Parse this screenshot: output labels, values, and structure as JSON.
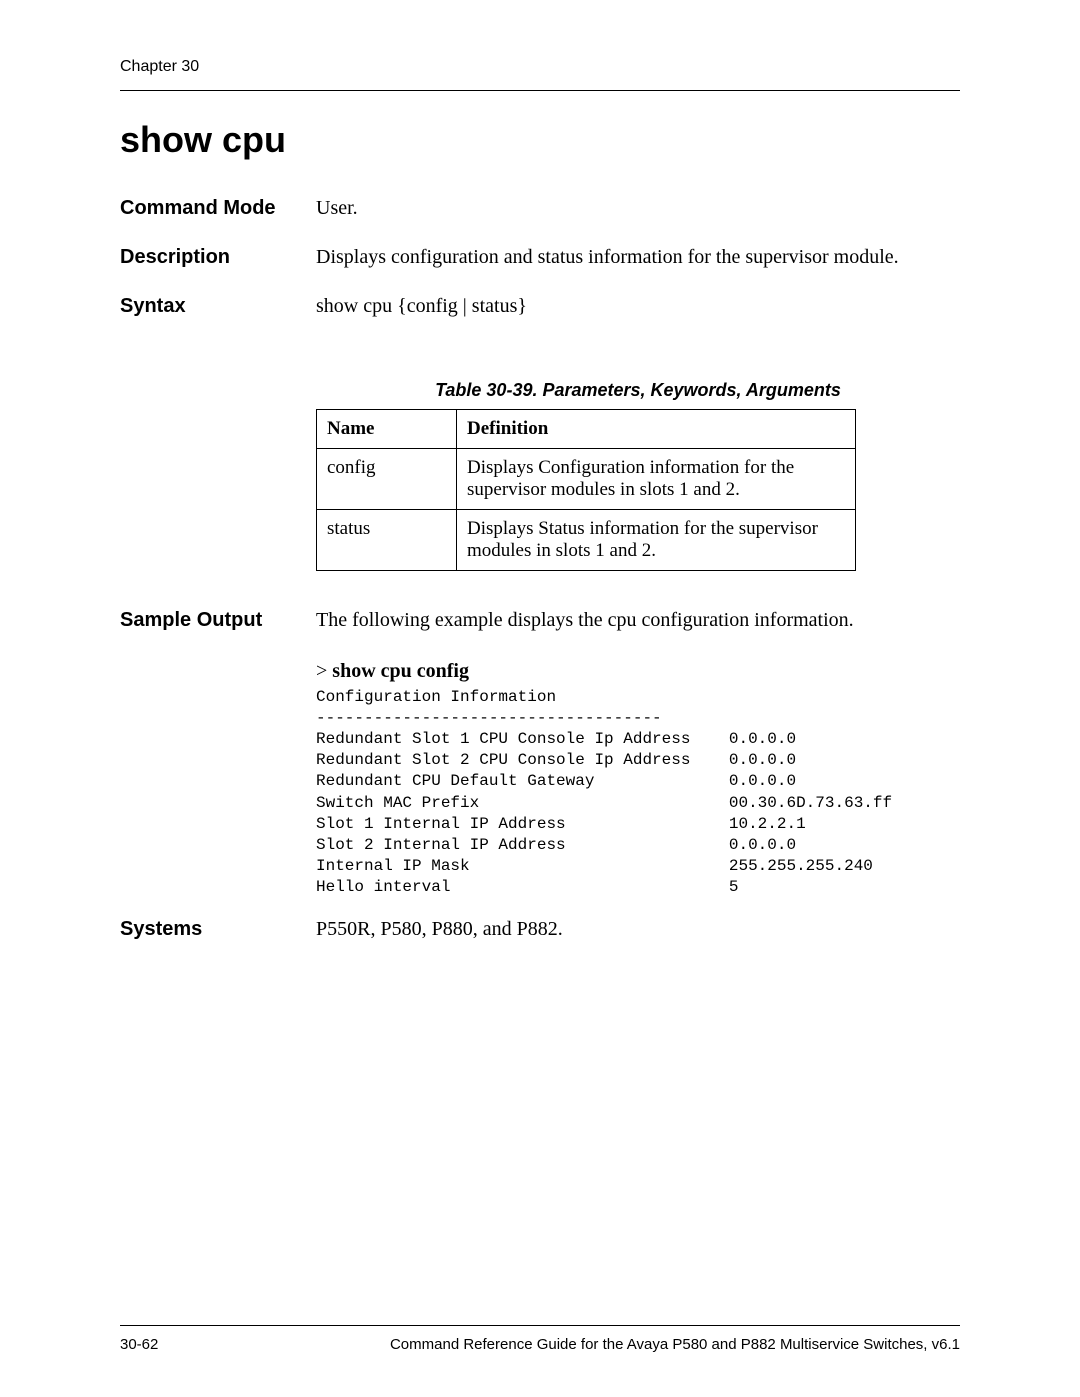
{
  "header": {
    "chapter_label": "Chapter 30"
  },
  "title": "show cpu",
  "sections": {
    "command_mode": {
      "label": "Command Mode",
      "value": "User."
    },
    "description": {
      "label": "Description",
      "value": "Displays configuration and status information for the supervisor module."
    },
    "syntax": {
      "label": "Syntax",
      "value": "show cpu {config | status}"
    },
    "sample_output": {
      "label": "Sample Output",
      "intro": "The following example displays the cpu configuration information."
    },
    "systems": {
      "label": "Systems",
      "value": "P550R, P580, P880, and P882."
    }
  },
  "table": {
    "caption": "Table 30-39.  Parameters, Keywords, Arguments",
    "headers": {
      "name": "Name",
      "definition": "Definition"
    },
    "rows": [
      {
        "name": "config",
        "definition": "Displays Configuration information for the supervisor modules in slots 1 and 2."
      },
      {
        "name": "status",
        "definition": "Displays Status information for the supervisor modules in slots 1 and 2."
      }
    ]
  },
  "sample": {
    "prompt": ">",
    "command": "show cpu config",
    "output": "Configuration Information\n------------------------------------\nRedundant Slot 1 CPU Console Ip Address    0.0.0.0\nRedundant Slot 2 CPU Console Ip Address    0.0.0.0\nRedundant CPU Default Gateway              0.0.0.0\nSwitch MAC Prefix                          00.30.6D.73.63.ff\nSlot 1 Internal IP Address                 10.2.2.1\nSlot 2 Internal IP Address                 0.0.0.0\nInternal IP Mask                           255.255.255.240\nHello interval                             5"
  },
  "footer": {
    "page_num": "30-62",
    "doc_title": "Command Reference Guide for the Avaya P580 and P882 Multiservice Switches, v6.1"
  }
}
